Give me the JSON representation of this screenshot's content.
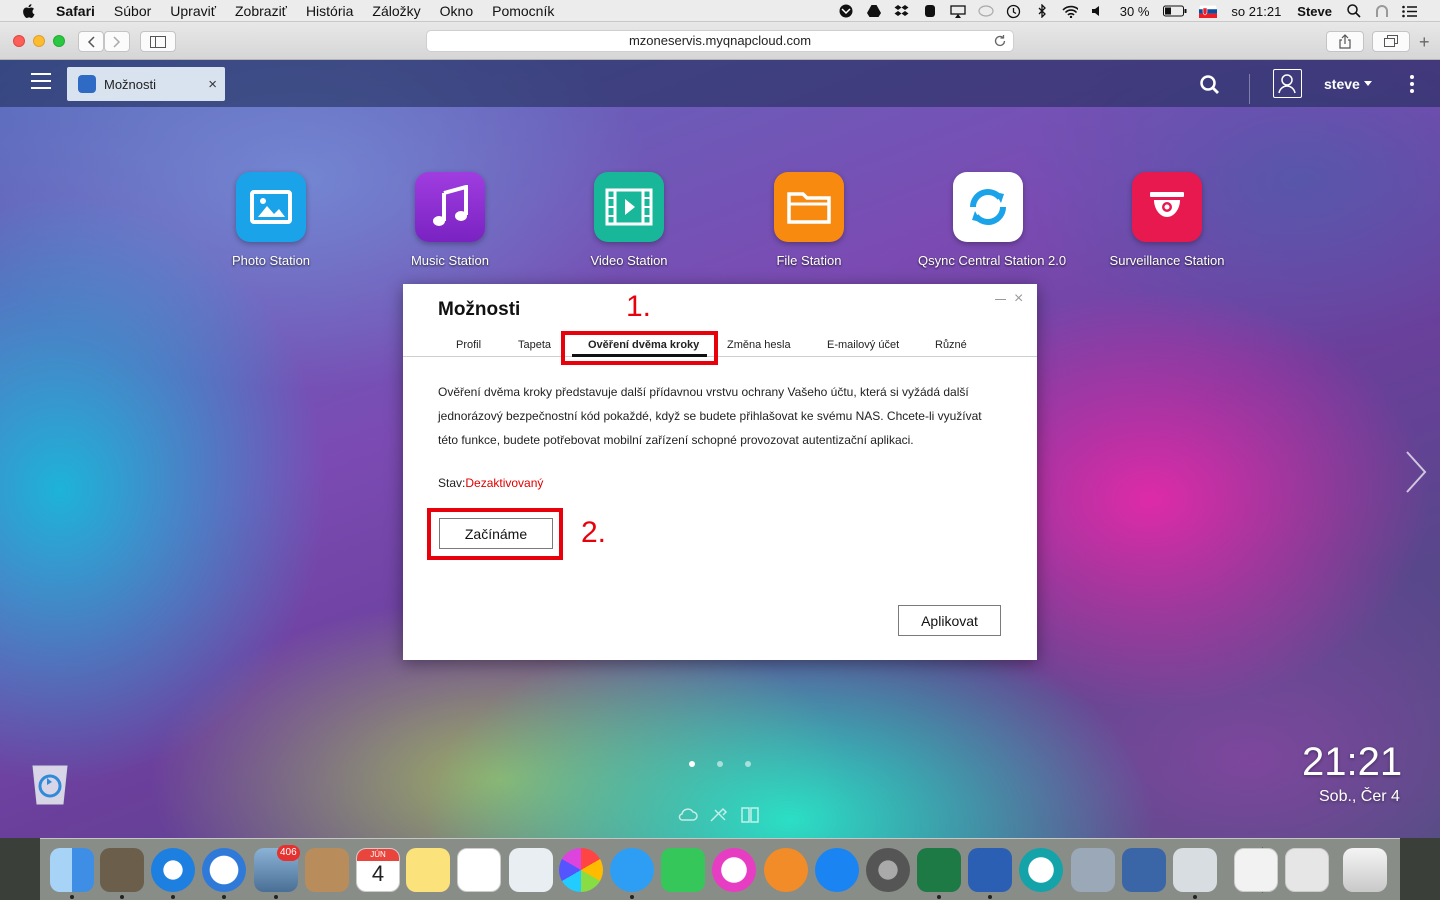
{
  "menubar": {
    "app_name": "Safari",
    "items": [
      "Súbor",
      "Upraviť",
      "Zobraziť",
      "História",
      "Záložky",
      "Okno",
      "Pomocník"
    ],
    "battery": "30 %",
    "clock": "so 21:21",
    "user": "Steve"
  },
  "browser": {
    "url": "mzoneservis.myqnapcloud.com"
  },
  "qnap": {
    "tab_label": "Možnosti",
    "tab_close": "×",
    "username": "steve"
  },
  "apps": [
    {
      "label": "Photo Station",
      "color": "#1aa3e8"
    },
    {
      "label": "Music Station",
      "color": "#8a2bd0"
    },
    {
      "label": "Video Station",
      "color": "#19b79a"
    },
    {
      "label": "File Station",
      "color": "#f98a10"
    },
    {
      "label": "Qsync Central Station 2.0",
      "color": "#ffffff"
    },
    {
      "label": "Surveillance Station",
      "color": "#e8194f"
    }
  ],
  "dialog": {
    "title": "Možnosti",
    "close": "×",
    "tabs": [
      "Profil",
      "Tapeta",
      "Ověření dvěma kroky",
      "Změna hesla",
      "E-mailový účet",
      "Různé"
    ],
    "active_tab": "Ověření dvěma kroky",
    "description": "Ověření dvěma kroky představuje další přídavnou vrstvu ochrany Vašeho účtu, která si vyžádá další jednorázový bezpečnostní kód pokaždé, když se budete přihlašovat ke svému NAS. Chcete-li využívat této funkce, budete potřebovat mobilní zařízení schopné provozovat autentizační aplikaci.",
    "status_label": "Stav:",
    "status_value": "Dezaktivovaný",
    "start_button": "Začínáme",
    "apply_button": "Aplikovat"
  },
  "annotations": {
    "step1": "1.",
    "step2": "2."
  },
  "desktop": {
    "time": "21:21",
    "date": "Sob., Čer 4"
  },
  "dock": {
    "mail_badge": "406",
    "calendar_month": "JÚN",
    "calendar_day": "4"
  }
}
